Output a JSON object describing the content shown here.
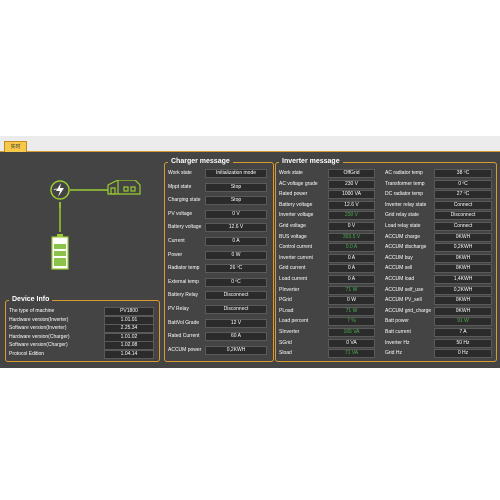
{
  "tab": {
    "label": "实时"
  },
  "device_info": {
    "title": "Device Info",
    "rows": [
      {
        "label": "The type of machine",
        "value": "PV1800"
      },
      {
        "label": "Hardware version(Inverter)",
        "value": "1.01.01"
      },
      {
        "label": "Software version(Inverter)",
        "value": "2.25.34"
      },
      {
        "label": "Hardware version(Charger)",
        "value": "1.01.02"
      },
      {
        "label": "Software version(Charger)",
        "value": "1.02.08"
      },
      {
        "label": "Protocol Edition",
        "value": "1.04.14"
      }
    ]
  },
  "charger": {
    "title": "Charger message",
    "rows": [
      {
        "label": "Work state",
        "value": "Initialization mode"
      },
      {
        "label": "Mppt state",
        "value": "Stop"
      },
      {
        "label": "Charging state",
        "value": "Stop"
      },
      {
        "label": "PV voltage",
        "value": "0 V"
      },
      {
        "label": "Battery voltage",
        "value": "12.6 V"
      },
      {
        "label": "Current",
        "value": "0 A"
      },
      {
        "label": "Power",
        "value": "0 W"
      },
      {
        "label": "Radiator temp",
        "value": "26 ºC"
      },
      {
        "label": "External temp",
        "value": "0 ºC"
      },
      {
        "label": "Battery Relay",
        "value": "Disconnect"
      },
      {
        "label": "PV Relay",
        "value": "Disconnect"
      },
      {
        "label": "BattVol Grade",
        "value": "12 V"
      },
      {
        "label": "Rated Current",
        "value": "60 A"
      },
      {
        "label": "ACCUM power",
        "value": "0,2KWH"
      }
    ]
  },
  "inverter": {
    "title": "Inverter message",
    "left": [
      {
        "label": "Work state",
        "value": "OffGrid",
        "green": false
      },
      {
        "label": "AC voltage grade",
        "value": "230 V",
        "green": false
      },
      {
        "label": "Rated power",
        "value": "1000 VA",
        "green": false
      },
      {
        "label": "Battery voltage",
        "value": "12.6 V",
        "green": false
      },
      {
        "label": "Inverter voltage",
        "value": "230 V",
        "green": true
      },
      {
        "label": "Grid voltage",
        "value": "0 V",
        "green": false
      },
      {
        "label": "BUS voltage",
        "value": "303.5 V",
        "green": true
      },
      {
        "label": "Control current",
        "value": "0.0 A",
        "green": true
      },
      {
        "label": "Inverter current",
        "value": "0 A",
        "green": false
      },
      {
        "label": "Grid current",
        "value": "0 A",
        "green": false
      },
      {
        "label": "Load current",
        "value": "0 A",
        "green": false
      },
      {
        "label": "PInverter",
        "value": "71 W",
        "green": true
      },
      {
        "label": "PGrid",
        "value": "0 W",
        "green": false
      },
      {
        "label": "PLoad",
        "value": "71 W",
        "green": true
      },
      {
        "label": "Load percent",
        "value": "7 %",
        "green": true
      },
      {
        "label": "SInverter",
        "value": "165 VA",
        "green": true
      },
      {
        "label": "SGrid",
        "value": "0 VA",
        "green": false
      },
      {
        "label": "Sload",
        "value": "71 VA",
        "green": true
      }
    ],
    "right": [
      {
        "label": "AC radiator temp",
        "value": "38 ºC",
        "green": false
      },
      {
        "label": "Transformer temp",
        "value": "0 ºC",
        "green": false
      },
      {
        "label": "DC radiator temp",
        "value": "27 ºC",
        "green": false
      },
      {
        "label": "Inverter relay state",
        "value": "Connect",
        "green": false
      },
      {
        "label": "Grid relay state",
        "value": "Disconnect",
        "green": false
      },
      {
        "label": "Load relay state",
        "value": "Connect",
        "green": false
      },
      {
        "label": "ACCUM charge",
        "value": "0KWH",
        "green": false
      },
      {
        "label": "ACCUM discharge",
        "value": "0,2KWH",
        "green": false
      },
      {
        "label": "ACCUM buy",
        "value": "0KWH",
        "green": false
      },
      {
        "label": "ACCUM sell",
        "value": "0KWH",
        "green": false
      },
      {
        "label": "ACCUM load",
        "value": "1,4KWH",
        "green": false
      },
      {
        "label": "ACCUM self_use",
        "value": "0,2KWH",
        "green": false
      },
      {
        "label": "ACCUM PV_sell",
        "value": "0KWH",
        "green": false
      },
      {
        "label": "ACCUM grid_charge",
        "value": "0KWH",
        "green": false
      },
      {
        "label": "Batt power",
        "value": "91 W",
        "green": true
      },
      {
        "label": "Batt current",
        "value": "7 A",
        "green": false
      },
      {
        "label": "Inverter Hz",
        "value": "50 Hz",
        "green": false
      },
      {
        "label": "Grid Hz",
        "value": "0 Hz",
        "green": false
      }
    ]
  },
  "diagram": {
    "icons": [
      "solar-inverter-icon",
      "house-icon",
      "battery-icon"
    ],
    "line_color": "#9acd32"
  },
  "colors": {
    "background": "#444444",
    "border_accent": "#d99a30",
    "tab": "#f6c94a",
    "green_value": "#4caf50"
  }
}
